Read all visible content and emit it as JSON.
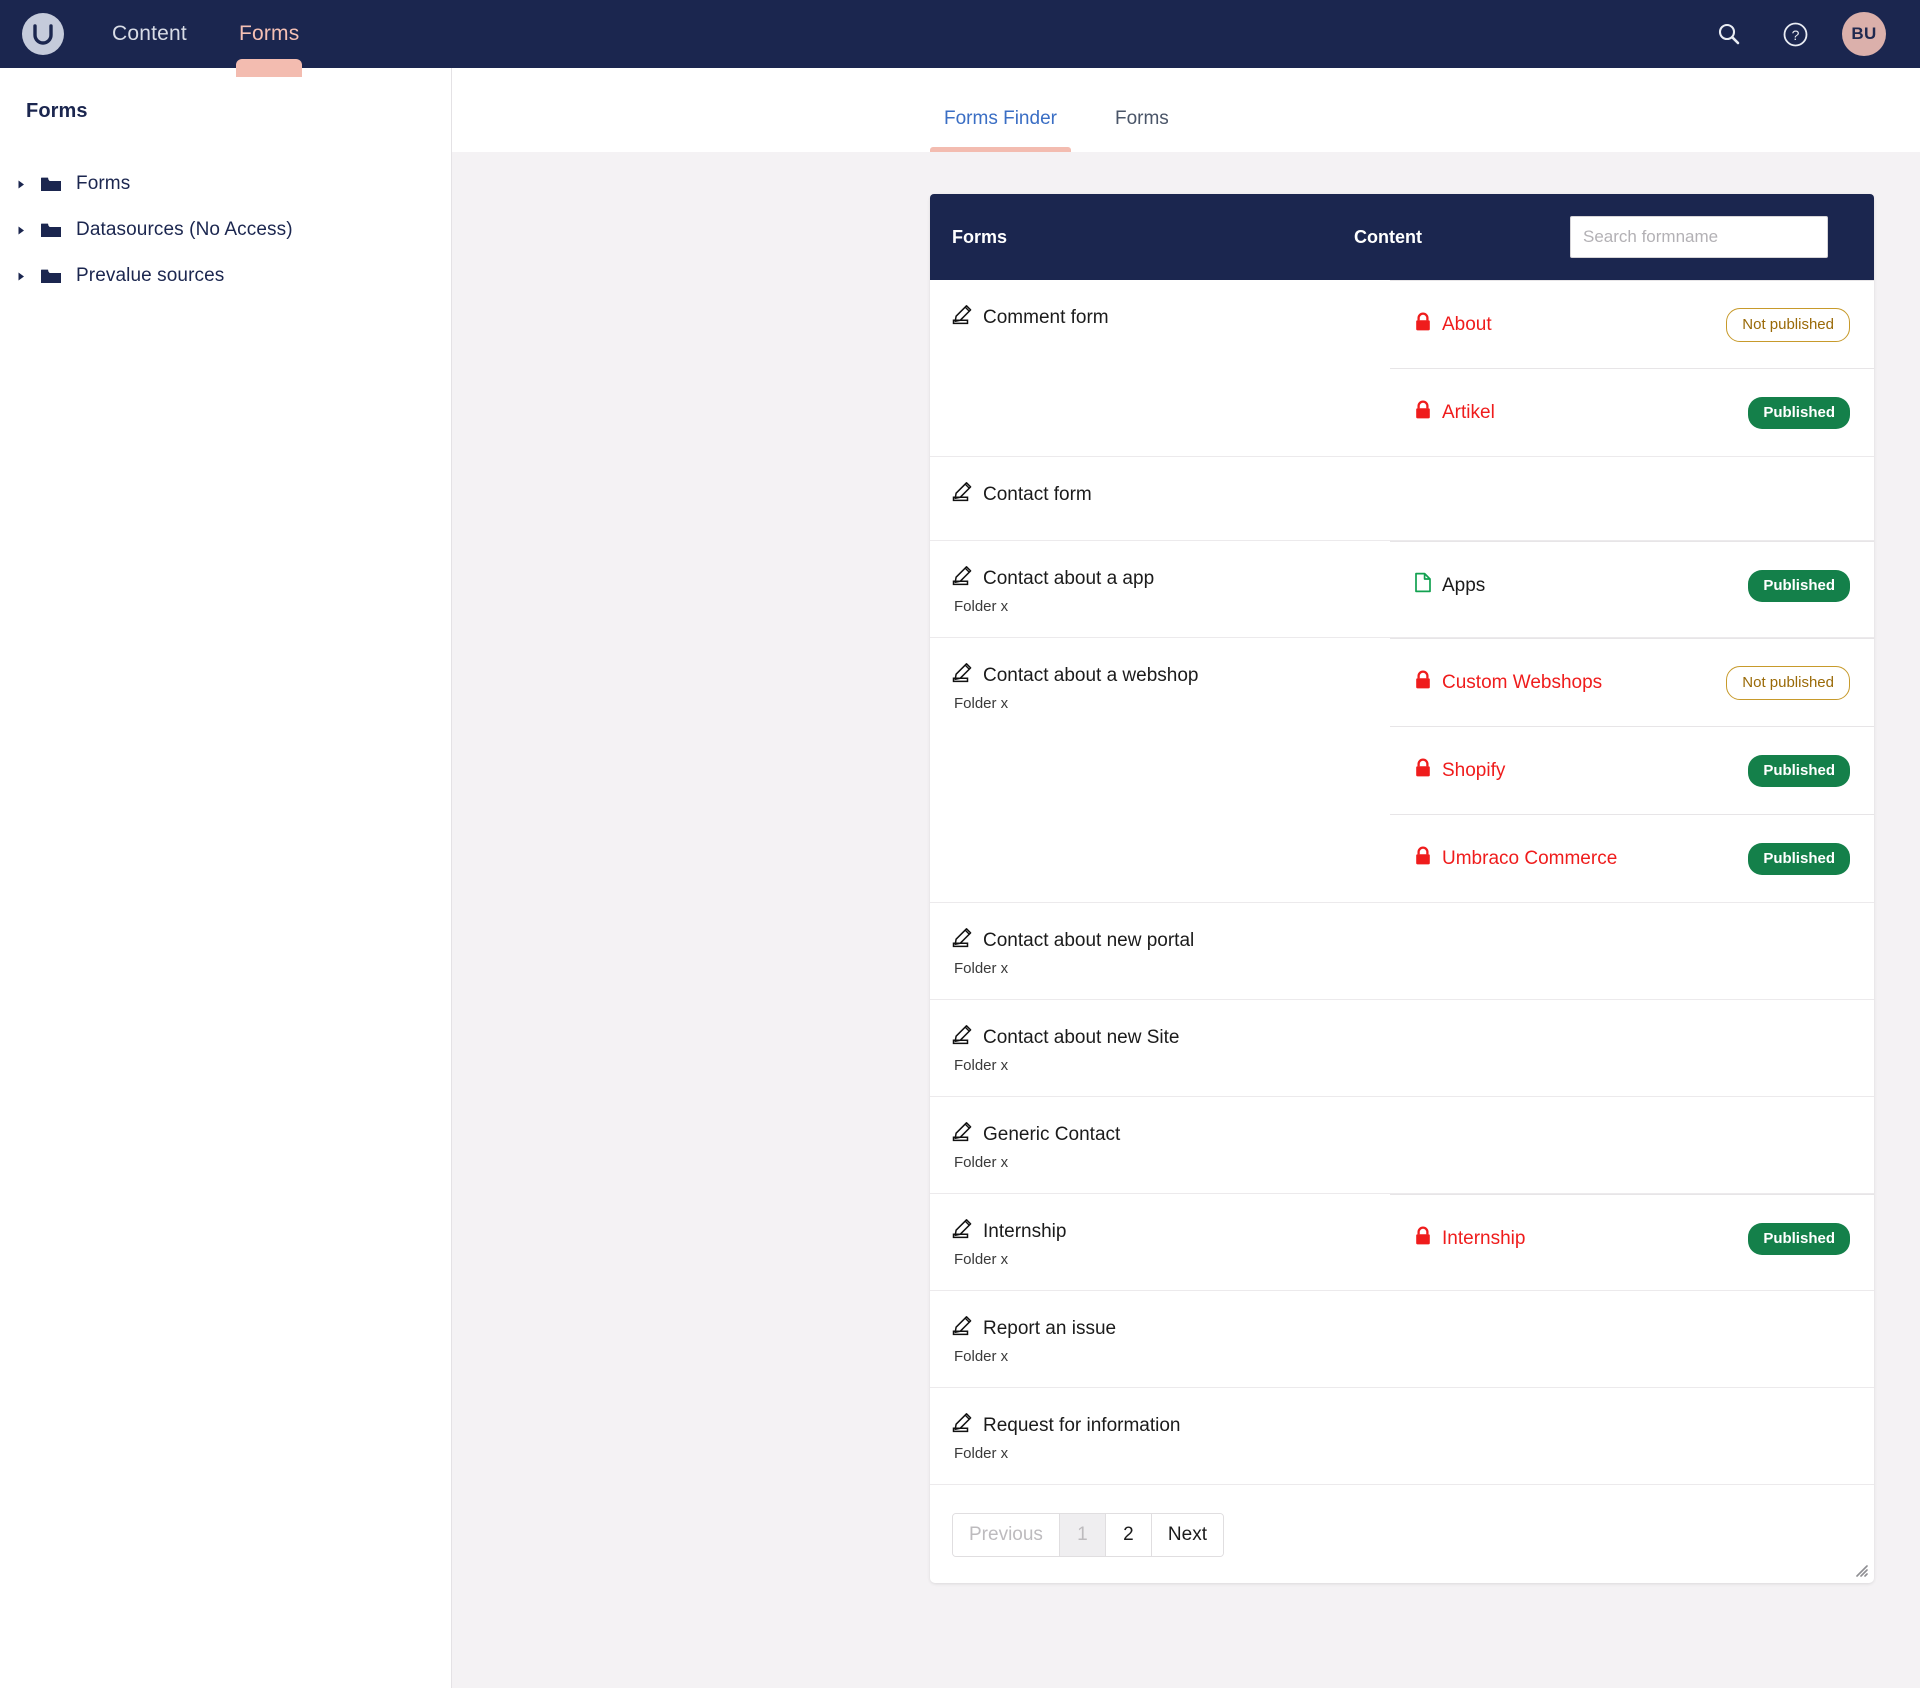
{
  "topbar": {
    "logo_icon": "umbraco-logo-icon",
    "nav": [
      {
        "label": "Content",
        "active": false
      },
      {
        "label": "Forms",
        "active": true
      }
    ],
    "search_icon": "search-icon",
    "help_icon": "help-circle-icon",
    "avatar_initials": "BU"
  },
  "sidebar": {
    "title": "Forms",
    "items": [
      {
        "label": "Forms",
        "icon": "folder-icon",
        "expand_icon": "chevron-right-icon"
      },
      {
        "label": "Datasources (No Access)",
        "icon": "folder-icon",
        "expand_icon": "chevron-right-icon"
      },
      {
        "label": "Prevalue sources",
        "icon": "folder-icon",
        "expand_icon": "chevron-right-icon"
      }
    ]
  },
  "tabs": [
    {
      "label": "Forms Finder",
      "active": true
    },
    {
      "label": "Forms",
      "active": false
    }
  ],
  "table": {
    "header": {
      "col_forms": "Forms",
      "col_content": "Content",
      "search_placeholder": "Search formname",
      "search_value": ""
    },
    "rows": [
      {
        "form": "Comment form",
        "folder": "",
        "icon": "form-edit-icon",
        "content": [
          {
            "name": "About",
            "icon": "lock-icon",
            "state": "locked",
            "status": "Not published",
            "status_type": "notpublished"
          },
          {
            "name": "Artikel",
            "icon": "lock-icon",
            "state": "locked",
            "status": "Published",
            "status_type": "published"
          }
        ]
      },
      {
        "form": "Contact form",
        "folder": "",
        "icon": "form-edit-icon",
        "content": []
      },
      {
        "form": "Contact about a app",
        "folder": "Folder x",
        "icon": "form-edit-icon",
        "content": [
          {
            "name": "Apps",
            "icon": "document-icon",
            "state": "open",
            "status": "Published",
            "status_type": "published"
          }
        ]
      },
      {
        "form": "Contact about a webshop",
        "folder": "Folder x",
        "icon": "form-edit-icon",
        "content": [
          {
            "name": "Custom Webshops",
            "icon": "lock-icon",
            "state": "locked",
            "status": "Not published",
            "status_type": "notpublished"
          },
          {
            "name": "Shopify",
            "icon": "lock-icon",
            "state": "locked",
            "status": "Published",
            "status_type": "published"
          },
          {
            "name": "Umbraco Commerce",
            "icon": "lock-icon",
            "state": "locked",
            "status": "Published",
            "status_type": "published"
          }
        ]
      },
      {
        "form": "Contact about new portal",
        "folder": "Folder x",
        "icon": "form-edit-icon",
        "content": []
      },
      {
        "form": "Contact about new Site",
        "folder": "Folder x",
        "icon": "form-edit-icon",
        "content": []
      },
      {
        "form": "Generic Contact",
        "folder": "Folder x",
        "icon": "form-edit-icon",
        "content": []
      },
      {
        "form": "Internship",
        "folder": "Folder x",
        "icon": "form-edit-icon",
        "content": [
          {
            "name": "Internship",
            "icon": "lock-icon",
            "state": "locked",
            "status": "Published",
            "status_type": "published"
          }
        ]
      },
      {
        "form": "Report an issue",
        "folder": "Folder x",
        "icon": "form-edit-icon",
        "content": []
      },
      {
        "form": "Request for information",
        "folder": "Folder x",
        "icon": "form-edit-icon",
        "content": []
      }
    ]
  },
  "pagination": [
    {
      "label": "Previous",
      "state": "disabled"
    },
    {
      "label": "1",
      "state": "current"
    },
    {
      "label": "2",
      "state": "normal"
    },
    {
      "label": "Next",
      "state": "normal"
    }
  ],
  "colors": {
    "brand_navy": "#1b264f",
    "accent_peach": "#f3bcb0",
    "locked_red": "#ef1c1c",
    "published_green": "#14804a",
    "notpublished_amber": "#9a6a08",
    "link_blue": "#3a6ec4",
    "page_bg": "#f4f2f4"
  },
  "resize_handle_icon": "resize-grip-icon"
}
